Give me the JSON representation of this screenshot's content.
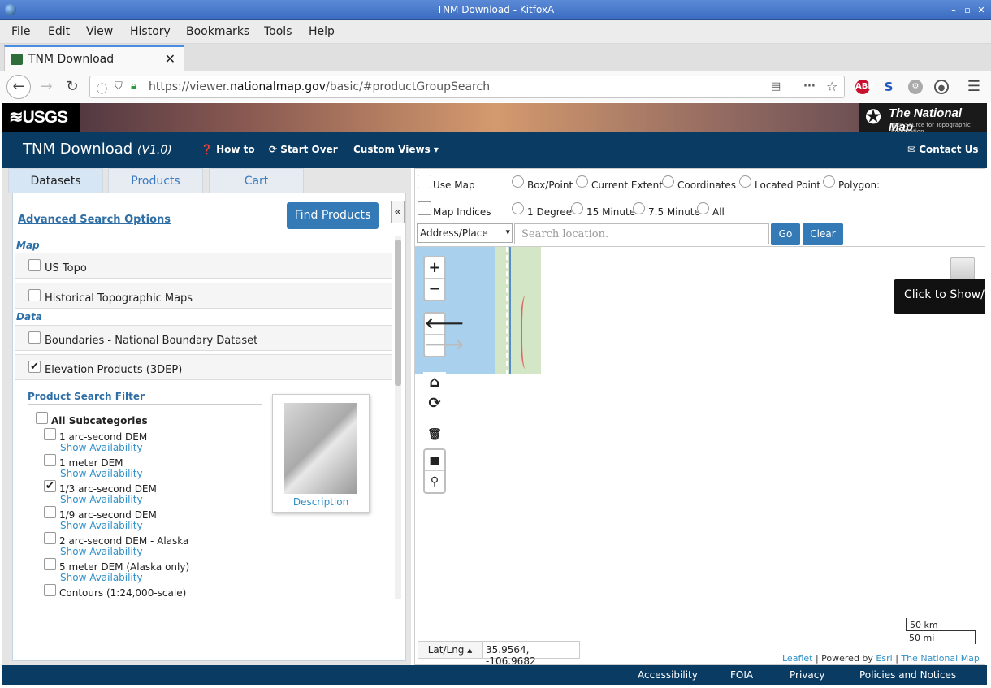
{
  "window": {
    "title": "TNM Download - KitfoxA"
  },
  "menu": [
    "File",
    "Edit",
    "View",
    "History",
    "Bookmarks",
    "Tools",
    "Help"
  ],
  "tab": {
    "title": "TNM Download"
  },
  "url": {
    "prefix": "https://viewer.",
    "domain": "nationalmap.gov",
    "path": "/basic/#productGroupSearch"
  },
  "banner": {
    "usgs": "≋USGS",
    "tnm_title": "The National Map",
    "tnm_sub": "Your Source for Topographic Information"
  },
  "app": {
    "title": "TNM Download",
    "version": "(V1.0)",
    "howto": "How to",
    "startover": "Start Over",
    "customviews": "Custom Views",
    "contact": "Contact Us"
  },
  "panel_tabs": [
    "Datasets",
    "Products",
    "Cart"
  ],
  "panel": {
    "advanced": "Advanced Search Options",
    "find": "Find Products",
    "section_map": "Map",
    "section_data": "Data",
    "items": [
      "US Topo",
      "Historical Topographic Maps",
      "Boundaries - National Boundary Dataset",
      "Elevation Products (3DEP)"
    ],
    "filter_title": "Product Search Filter",
    "all_sub": "All Subcategories",
    "subcats": [
      "1 arc-second DEM",
      "1 meter DEM",
      "1/3 arc-second DEM",
      "1/9 arc-second DEM",
      "2 arc-second DEM - Alaska",
      "5 meter DEM (Alaska only)",
      "Contours (1:24,000-scale)"
    ],
    "show_avail": "Show Availability",
    "description": "Description"
  },
  "options": {
    "use_map": "Use Map",
    "box": "Box/Point",
    "extent": "Current Extent",
    "coords": "Coordinates",
    "located": "Located Point",
    "polygon": "Polygon:",
    "indices": "Map Indices",
    "deg1": "1 Degree",
    "min15": "15 Minute",
    "min75": "7.5 Minute",
    "all": "All"
  },
  "search": {
    "type": "Address/Place",
    "placeholder": "Search location.",
    "go": "Go",
    "clear": "Clear"
  },
  "map": {
    "tooltip": "Click to Show/Hide",
    "scale_km": "50 km",
    "scale_mi": "50 mi",
    "latlng_btn": "Lat/Lng ▴",
    "coords": "35.9564, -106.9682",
    "attr_leaflet": "Leaflet",
    "attr_powered": "| Powered by",
    "attr_esri": "Esri",
    "attr_sep": "|",
    "attr_tnm": "The National Map"
  },
  "footer": [
    "Accessibility",
    "FOIA",
    "Privacy",
    "Policies and Notices"
  ]
}
